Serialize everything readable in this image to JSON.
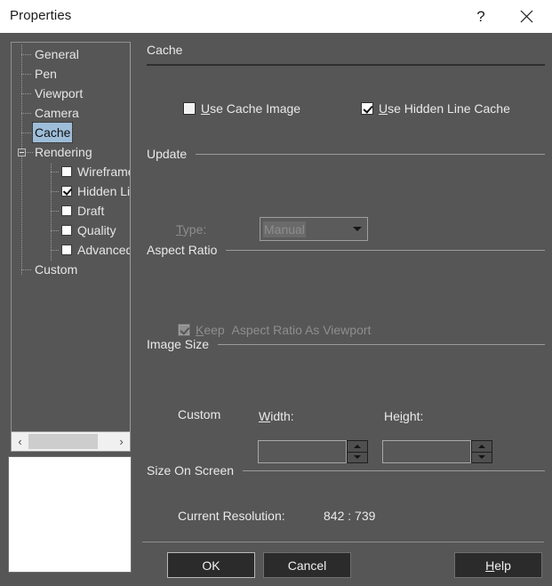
{
  "window": {
    "title": "Properties",
    "help_button": "?",
    "close_button": "✕"
  },
  "tree": {
    "items": [
      {
        "label": "General",
        "level": 0,
        "checkbox": null,
        "selected": false,
        "expander": null
      },
      {
        "label": "Pen",
        "level": 0,
        "checkbox": null,
        "selected": false,
        "expander": null
      },
      {
        "label": "Viewport",
        "level": 0,
        "checkbox": null,
        "selected": false,
        "expander": null
      },
      {
        "label": "Camera",
        "level": 0,
        "checkbox": null,
        "selected": false,
        "expander": null
      },
      {
        "label": "Cache",
        "level": 0,
        "checkbox": null,
        "selected": true,
        "expander": null
      },
      {
        "label": "Rendering",
        "level": 0,
        "checkbox": null,
        "selected": false,
        "expander": "minus"
      },
      {
        "label": "Wireframe",
        "level": 1,
        "checkbox": false,
        "selected": false,
        "expander": null
      },
      {
        "label": "Hidden Line",
        "level": 1,
        "checkbox": true,
        "selected": false,
        "expander": null
      },
      {
        "label": "Draft",
        "level": 1,
        "checkbox": false,
        "selected": false,
        "expander": null
      },
      {
        "label": "Quality",
        "level": 1,
        "checkbox": false,
        "selected": false,
        "expander": null
      },
      {
        "label": "Advanced",
        "level": 1,
        "checkbox": false,
        "selected": false,
        "expander": null
      },
      {
        "label": "Custom",
        "level": 0,
        "checkbox": null,
        "selected": false,
        "expander": null
      }
    ],
    "scroll_left_arrow": "‹",
    "scroll_right_arrow": "›"
  },
  "content": {
    "page_title": "Cache",
    "top_checkboxes": [
      {
        "label_mnemonic": "U",
        "label_rest": "se Cache Image",
        "checked": false,
        "disabled": false
      },
      {
        "label_mnemonic": "U",
        "label_rest": "se Hidden Line Cache",
        "checked": true,
        "disabled": false
      }
    ],
    "update": {
      "group_label": "Update",
      "type_label_mnemonic": "T",
      "type_label_rest": "ype:",
      "type_value": "Manual",
      "disabled": true
    },
    "aspect_ratio": {
      "group_label": "Aspect Ratio",
      "checkbox_mnemonic": "K",
      "checkbox_rest": "eep",
      "checkbox_text": "Aspect Ratio As Viewport",
      "checked": true,
      "disabled": true
    },
    "image_size": {
      "group_label": "Image Size",
      "custom_label": "Custom",
      "width_mnemonic": "W",
      "width_rest": "idth:",
      "height_mnemonic": "H",
      "height_rest_a": "e",
      "height_mn2": "i",
      "height_rest_b": "ght:",
      "height_label": "Height:",
      "width_value": "",
      "height_value": ""
    },
    "size_on_screen": {
      "group_label": "Size On Screen",
      "current_resolution_label": "Current Resolution:",
      "current_resolution_value": "842 : 739"
    }
  },
  "footer": {
    "ok": "OK",
    "cancel": "Cancel",
    "help_mnemonic": "H",
    "help_rest": "elp"
  },
  "colors": {
    "dialog_bg": "#565656",
    "titlebar_bg": "#ffffff",
    "selection_blue": "#9dbdd9",
    "text": "#e9e9e9",
    "disabled_text": "#8e8e8e"
  }
}
